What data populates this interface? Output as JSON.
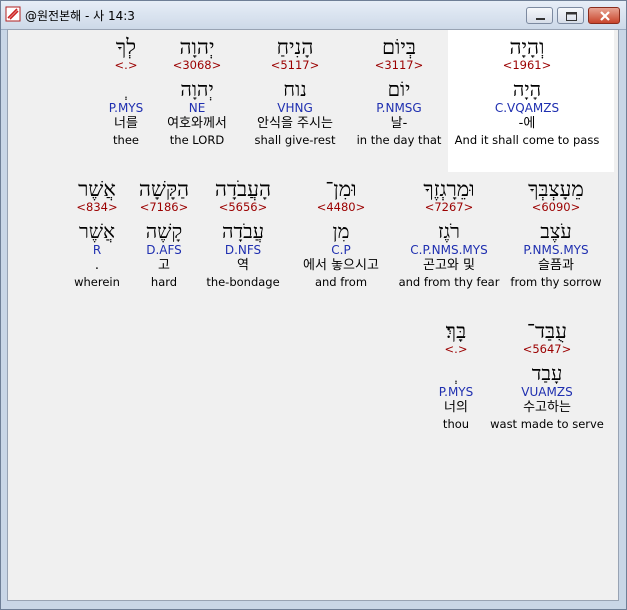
{
  "window": {
    "title": "@원전본해 - 사 14:3",
    "minimize_icon": "minimize-icon",
    "maximize_icon": "maximize-icon",
    "close_icon": "close-icon"
  },
  "rows": [
    {
      "words": [
        {
          "heb": "וְהָיָה",
          "strong": "<1961>",
          "lemma": "הָיָה",
          "morph": "C.VQAMZS",
          "korean": "-에",
          "english": "And it shall come to pass"
        },
        {
          "heb": "בְּיוֹם",
          "strong": "<3117>",
          "lemma": "יוֹם",
          "morph": "P.NMSG",
          "korean": "날-",
          "english": "in the day that"
        },
        {
          "heb": "הָנִיחַ",
          "strong": "<5117>",
          "lemma": "נוח",
          "morph": "VHNG",
          "korean": "안식을 주시는",
          "english": "shall give-rest"
        },
        {
          "heb": "יְהוָה",
          "strong": "<3068>",
          "lemma": "יְהוָה",
          "morph": "NE",
          "korean": "여호와께서",
          "english": "the LORD"
        },
        {
          "heb": "לְךָ",
          "strong": "<.>",
          "lemma": "ְ",
          "morph": "P.MYS",
          "korean": "너를",
          "english": "thee"
        }
      ]
    },
    {
      "words": [
        {
          "heb": "מֵעָצְבְּךָ",
          "strong": "<6090>",
          "lemma": "עֹצֶב",
          "morph": "P.NMS.MYS",
          "korean": "슬픔과",
          "english": "from thy sorrow"
        },
        {
          "heb": "וּמֵרָגְזֶךָ",
          "strong": "<7267>",
          "lemma": "רֹגֶז",
          "morph": "C.P.NMS.MYS",
          "korean": "곤고와 및",
          "english": "and from thy fear"
        },
        {
          "heb": "וּמִן־",
          "strong": "<4480>",
          "lemma": "מִן",
          "morph": "C.P",
          "korean": "에서 놓으시고",
          "english": "and from"
        },
        {
          "heb": "הָעֲבֹדָה",
          "strong": "<5656>",
          "lemma": "עֲבֹדָה",
          "morph": "D.NFS",
          "korean": "역",
          "english": "the-bondage"
        },
        {
          "heb": "הַקָּשָׁה",
          "strong": "<7186>",
          "lemma": "קָשֶׁה",
          "morph": "D.AFS",
          "korean": "고",
          "english": "hard"
        },
        {
          "heb": "אֲשֶׁר",
          "strong": "<834>",
          "lemma": "אֲשֶׁר",
          "morph": "R",
          "korean": ".",
          "english": "wherein"
        }
      ]
    },
    {
      "words": [
        {
          "heb": "עֻבַּד־",
          "strong": "<5647>",
          "lemma": "עָבַד",
          "morph": "VUAMZS",
          "korean": "수고하는",
          "english": "wast made to serve"
        },
        {
          "heb": "בָּךְ׃",
          "strong": "<.>",
          "lemma": "ְ",
          "morph": "P.MYS",
          "korean": "너의",
          "english": "thou"
        }
      ]
    }
  ]
}
